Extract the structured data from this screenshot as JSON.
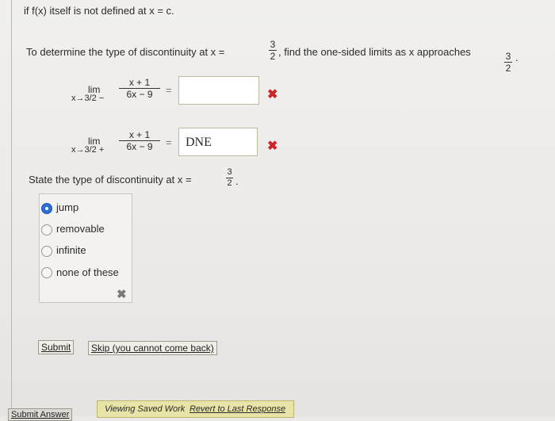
{
  "intro_text": "if f(x) itself is not defined at x = c.",
  "determine": {
    "prefix": "To determine the type of discontinuity at x =",
    "frac_num": "3",
    "frac_den": "2",
    "middle": ", find the one-sided limits as x approaches",
    "end_num": "3",
    "end_den": "2",
    "end_suffix": "."
  },
  "limits": [
    {
      "lim_word": "lim",
      "approach": "x→3/2 −",
      "numerator": "x + 1",
      "denominator": "6x − 9",
      "equals": "=",
      "answer": "",
      "status_icon": "incorrect-x-icon"
    },
    {
      "lim_word": "lim",
      "approach": "x→3/2 +",
      "numerator": "x + 1",
      "denominator": "6x − 9",
      "equals": "=",
      "answer": "DNE",
      "status_icon": "incorrect-x-icon"
    }
  ],
  "state": {
    "prefix": "State the type of discontinuity at x =",
    "frac_num": "3",
    "frac_den": "2",
    "suffix": "."
  },
  "options": [
    {
      "label": "jump",
      "selected": true
    },
    {
      "label": "removable",
      "selected": false
    },
    {
      "label": "infinite",
      "selected": false
    },
    {
      "label": "none of these",
      "selected": false
    }
  ],
  "panel_status_icon": "incorrect-x-icon",
  "buttons": {
    "submit": "Submit",
    "skip": "Skip (you cannot come back)",
    "submit_answer": "Submit Answer"
  },
  "footer": {
    "viewing": "Viewing Saved Work",
    "revert": "Revert to Last Response"
  },
  "colors": {
    "incorrect": "#c8262a",
    "radio_selected": "#2c6fd6",
    "footer_bg": "#e8e4a8"
  }
}
